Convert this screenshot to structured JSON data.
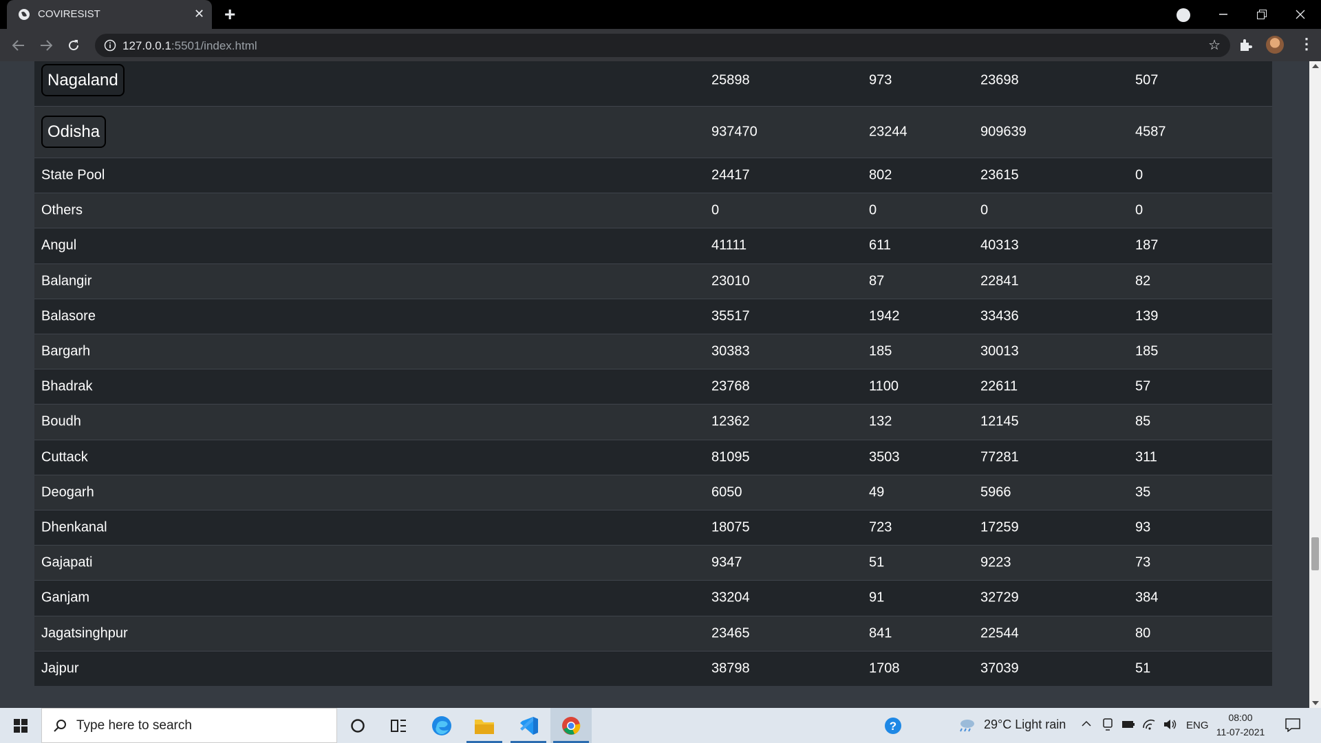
{
  "browser": {
    "tab_title": "COVIRESIST",
    "new_tab_label": "+",
    "url_host": "127.0.0.1",
    "url_path": ":5501/index.html"
  },
  "rows": [
    {
      "name": "Nagaland",
      "v1": "25898",
      "v2": "973",
      "v3": "23698",
      "v4": "507",
      "state": true
    },
    {
      "name": "Odisha",
      "v1": "937470",
      "v2": "23244",
      "v3": "909639",
      "v4": "4587",
      "state": true
    },
    {
      "name": "State Pool",
      "v1": "24417",
      "v2": "802",
      "v3": "23615",
      "v4": "0"
    },
    {
      "name": "Others",
      "v1": "0",
      "v2": "0",
      "v3": "0",
      "v4": "0"
    },
    {
      "name": "Angul",
      "v1": "41111",
      "v2": "611",
      "v3": "40313",
      "v4": "187"
    },
    {
      "name": "Balangir",
      "v1": "23010",
      "v2": "87",
      "v3": "22841",
      "v4": "82"
    },
    {
      "name": "Balasore",
      "v1": "35517",
      "v2": "1942",
      "v3": "33436",
      "v4": "139"
    },
    {
      "name": "Bargarh",
      "v1": "30383",
      "v2": "185",
      "v3": "30013",
      "v4": "185"
    },
    {
      "name": "Bhadrak",
      "v1": "23768",
      "v2": "1100",
      "v3": "22611",
      "v4": "57"
    },
    {
      "name": "Boudh",
      "v1": "12362",
      "v2": "132",
      "v3": "12145",
      "v4": "85"
    },
    {
      "name": "Cuttack",
      "v1": "81095",
      "v2": "3503",
      "v3": "77281",
      "v4": "311"
    },
    {
      "name": "Deogarh",
      "v1": "6050",
      "v2": "49",
      "v3": "5966",
      "v4": "35"
    },
    {
      "name": "Dhenkanal",
      "v1": "18075",
      "v2": "723",
      "v3": "17259",
      "v4": "93"
    },
    {
      "name": "Gajapati",
      "v1": "9347",
      "v2": "51",
      "v3": "9223",
      "v4": "73"
    },
    {
      "name": "Ganjam",
      "v1": "33204",
      "v2": "91",
      "v3": "32729",
      "v4": "384"
    },
    {
      "name": "Jagatsinghpur",
      "v1": "23465",
      "v2": "841",
      "v3": "22544",
      "v4": "80"
    },
    {
      "name": "Jajpur",
      "v1": "38798",
      "v2": "1708",
      "v3": "37039",
      "v4": "51"
    }
  ],
  "taskbar": {
    "search_placeholder": "Type here to search",
    "weather": "29°C  Light rain",
    "language": "ENG",
    "time": "08:00",
    "date": "11-07-2021"
  }
}
